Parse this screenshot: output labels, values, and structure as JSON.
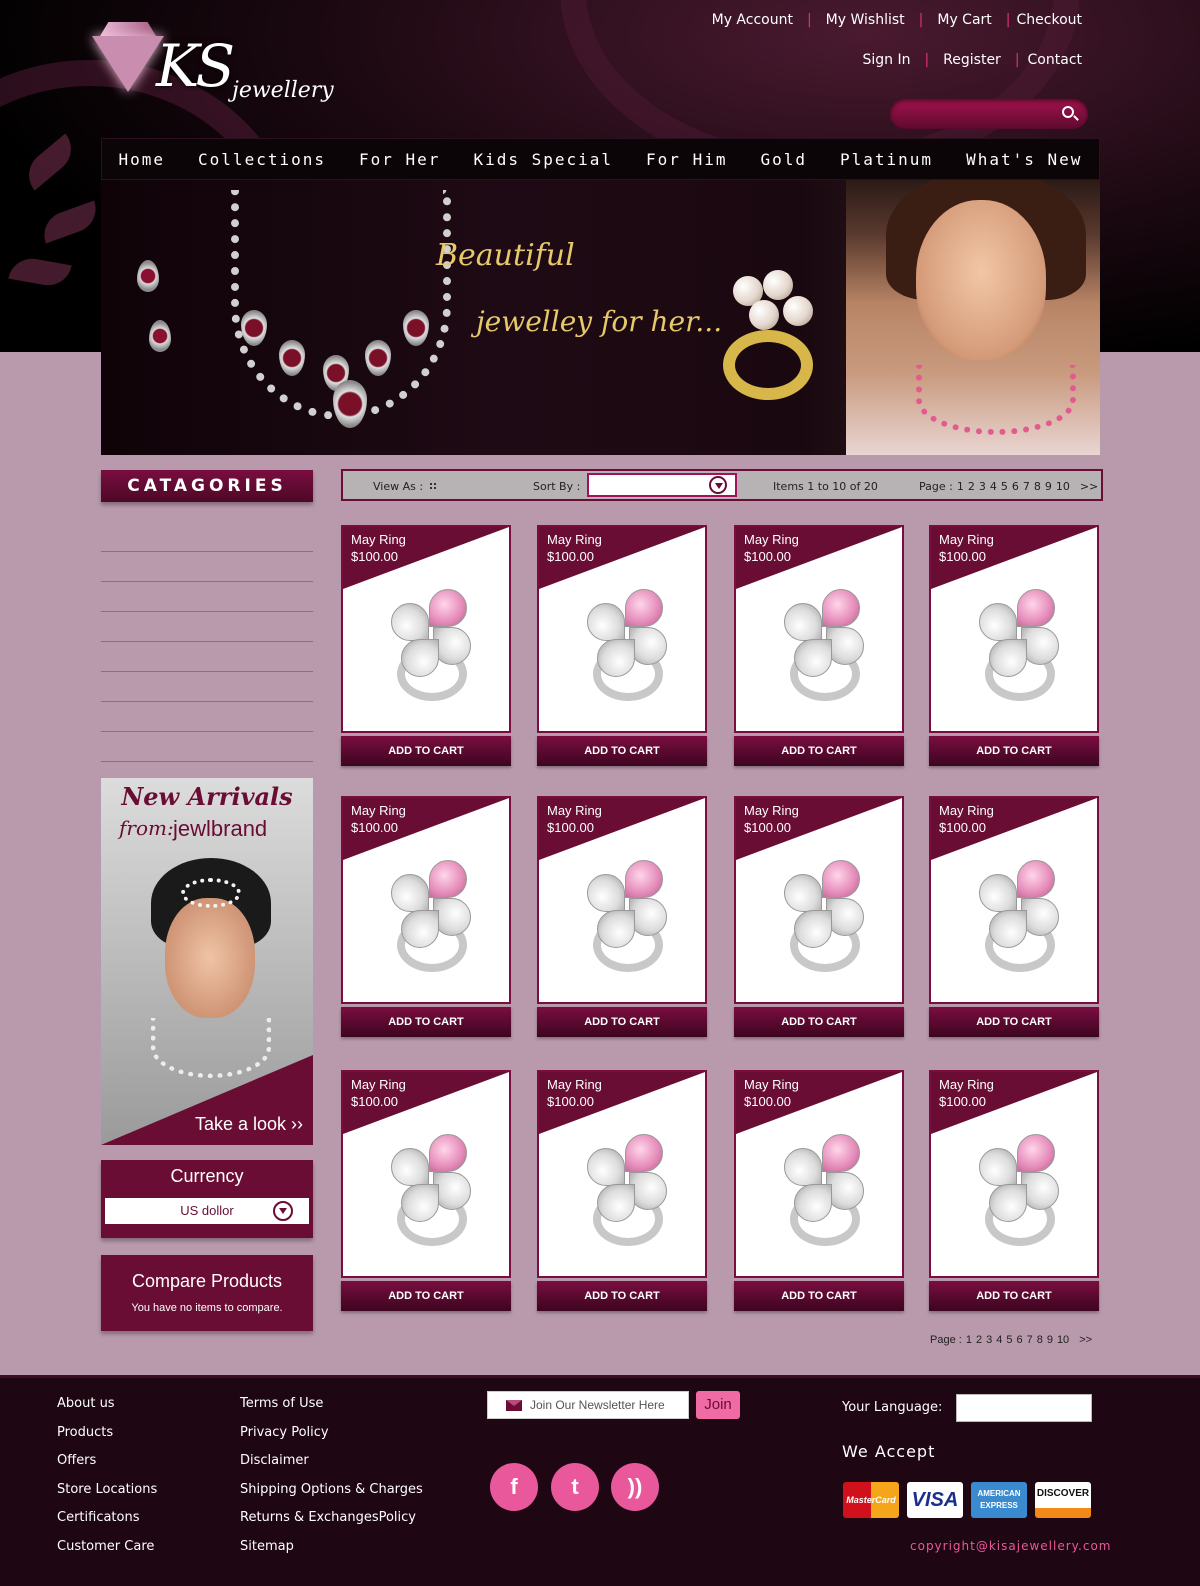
{
  "brand": {
    "initials": "KS",
    "name": "jewellery"
  },
  "top_links_row1": [
    "My Account",
    "My Wishlist",
    "My Cart",
    "Checkout"
  ],
  "top_links_row2": [
    "Sign In",
    "Register",
    "Contact"
  ],
  "search": {
    "placeholder": ""
  },
  "nav": [
    "Home",
    "Collections",
    "For Her",
    "Kids Special",
    "For Him",
    "Gold",
    "Platinum",
    "What's New"
  ],
  "banner": {
    "line1": "Beautiful",
    "line2": "jewelley for her..."
  },
  "sidebar": {
    "categories_title": "CATAGORIES",
    "category_items": [
      "",
      "",
      "",
      "",
      "",
      "",
      "",
      "",
      ""
    ],
    "new_arrivals": {
      "title": "New Arrivals",
      "from": "from:",
      "brand": "jewlbrand",
      "cta": "Take a look ››"
    },
    "currency": {
      "title": "Currency",
      "selected": "US dollor"
    },
    "compare": {
      "title": "Compare Products",
      "text": "You have no items to compare."
    }
  },
  "toolbar": {
    "view_as": "View As :",
    "sort_by": "Sort By :",
    "sort_selected": "",
    "items": "Items 1 to 10 of 20",
    "page_label": "Page :",
    "pages": [
      "1",
      "2",
      "3",
      "4",
      "5",
      "6",
      "7",
      "8",
      "9",
      "10",
      ">>"
    ]
  },
  "products": [
    {
      "name": "May Ring",
      "price": "$100.00",
      "button": "ADD TO CART"
    },
    {
      "name": "May Ring",
      "price": "$100.00",
      "button": "ADD TO CART"
    },
    {
      "name": "May Ring",
      "price": "$100.00",
      "button": "ADD TO CART"
    },
    {
      "name": "May Ring",
      "price": "$100.00",
      "button": "ADD TO CART"
    },
    {
      "name": "May Ring",
      "price": "$100.00",
      "button": "ADD TO CART"
    },
    {
      "name": "May Ring",
      "price": "$100.00",
      "button": "ADD TO CART"
    },
    {
      "name": "May Ring",
      "price": "$100.00",
      "button": "ADD TO CART"
    },
    {
      "name": "May Ring",
      "price": "$100.00",
      "button": "ADD TO CART"
    },
    {
      "name": "May Ring",
      "price": "$100.00",
      "button": "ADD TO CART"
    },
    {
      "name": "May Ring",
      "price": "$100.00",
      "button": "ADD TO CART"
    },
    {
      "name": "May Ring",
      "price": "$100.00",
      "button": "ADD TO CART"
    },
    {
      "name": "May Ring",
      "price": "$100.00",
      "button": "ADD TO CART"
    }
  ],
  "footer": {
    "col1": [
      "About us",
      "Products",
      "Offers",
      "Store Locations",
      "Certificatons",
      "Customer Care"
    ],
    "col2": [
      "Terms of Use",
      "Privacy Policy",
      "Disclaimer",
      "Shipping Options & Charges",
      "Returns & ExchangesPolicy",
      "Sitemap"
    ],
    "newsletter_placeholder": "Join Our Newsletter Here",
    "join": "Join",
    "social": [
      {
        "icon": "facebook-icon",
        "glyph": "f"
      },
      {
        "icon": "twitter-icon",
        "glyph": "t"
      },
      {
        "icon": "rss-icon",
        "glyph": "))"
      }
    ],
    "language_label": "Your Language:",
    "we_accept": "We Accept",
    "cards": [
      {
        "name": "MasterCard",
        "icon": "mastercard-icon"
      },
      {
        "name": "VISA",
        "icon": "visa-icon"
      },
      {
        "name": "AMERICAN EXPRESS",
        "icon": "amex-icon"
      },
      {
        "name": "DISCOVER",
        "icon": "discover-icon"
      }
    ],
    "copyright": "copyright@kisajewellery.com"
  },
  "colors": {
    "accent": "#6a0d34",
    "pink": "#e9589a",
    "page_bg": "#b99aac",
    "header_bg": "#000000"
  }
}
